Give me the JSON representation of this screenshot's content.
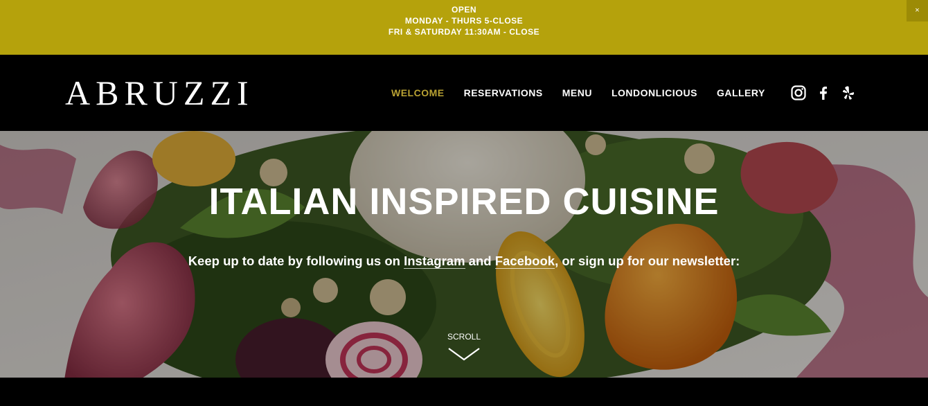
{
  "announcement": {
    "lines": [
      "OPEN",
      "MONDAY - THURS 5-CLOSE",
      "FRI & SATURDAY 11:30AM - CLOSE"
    ],
    "close_label": "×",
    "bg_color": "#b5a20c"
  },
  "header": {
    "logo": "ABRUZZI",
    "nav": [
      {
        "label": "WELCOME",
        "active": true
      },
      {
        "label": "RESERVATIONS"
      },
      {
        "label": "MENU"
      },
      {
        "label": "LONDONLICIOUS"
      },
      {
        "label": "GALLERY"
      }
    ],
    "active_color": "#b9a233",
    "social": [
      "instagram-icon",
      "facebook-icon",
      "yelp-icon"
    ]
  },
  "hero": {
    "title": "ITALIAN INSPIRED CUISINE",
    "sub_before": "Keep up to date by following us on ",
    "link_instagram": "Instagram",
    "sub_and": " and ",
    "link_facebook": "Facebook",
    "sub_after": ", or sign up for our newsletter:",
    "scroll_label": "SCROLL"
  }
}
